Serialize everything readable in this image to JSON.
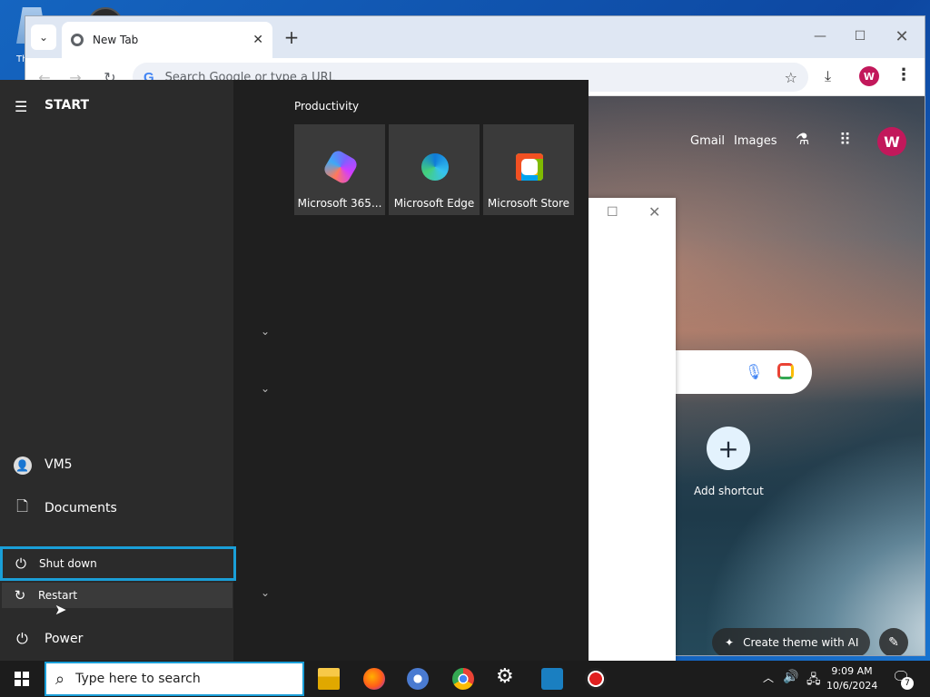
{
  "desktop": {
    "recycle_label": "Th"
  },
  "chrome": {
    "tab_title": "New Tab",
    "tab_close": "✕",
    "new_tab": "+",
    "window_controls": {
      "minimize": "—",
      "maximize": "☐",
      "close": "✕"
    },
    "omnibox_placeholder": "Search Google or type a URL",
    "omnibox_g": "G",
    "profile_initial": "W",
    "ntp": {
      "gmail": "Gmail",
      "images": "Images",
      "avatar_initial": "W",
      "add_shortcut": "Add shortcut",
      "create_theme": "Create theme with AI"
    }
  },
  "start_menu": {
    "title": "START",
    "group_title": "Productivity",
    "tiles": [
      {
        "label": "Microsoft 365...",
        "icon": "microsoft-365-icon"
      },
      {
        "label": "Microsoft Edge",
        "icon": "edge-icon"
      },
      {
        "label": "Microsoft Store",
        "icon": "store-icon"
      }
    ],
    "sidebar": {
      "user": "VM5",
      "documents": "Documents",
      "power": "Power"
    },
    "power_menu": {
      "shut_down": "Shut down",
      "restart": "Restart"
    }
  },
  "taskbar": {
    "search_placeholder": "Type here to search",
    "time": "9:09 AM",
    "date": "10/6/2024",
    "notification_count": "7"
  },
  "colors": {
    "accent": "#1a9fd8",
    "profile": "#c2185b",
    "start_bg": "#1f1f1f",
    "taskbar_bg": "#1c1c1c"
  }
}
